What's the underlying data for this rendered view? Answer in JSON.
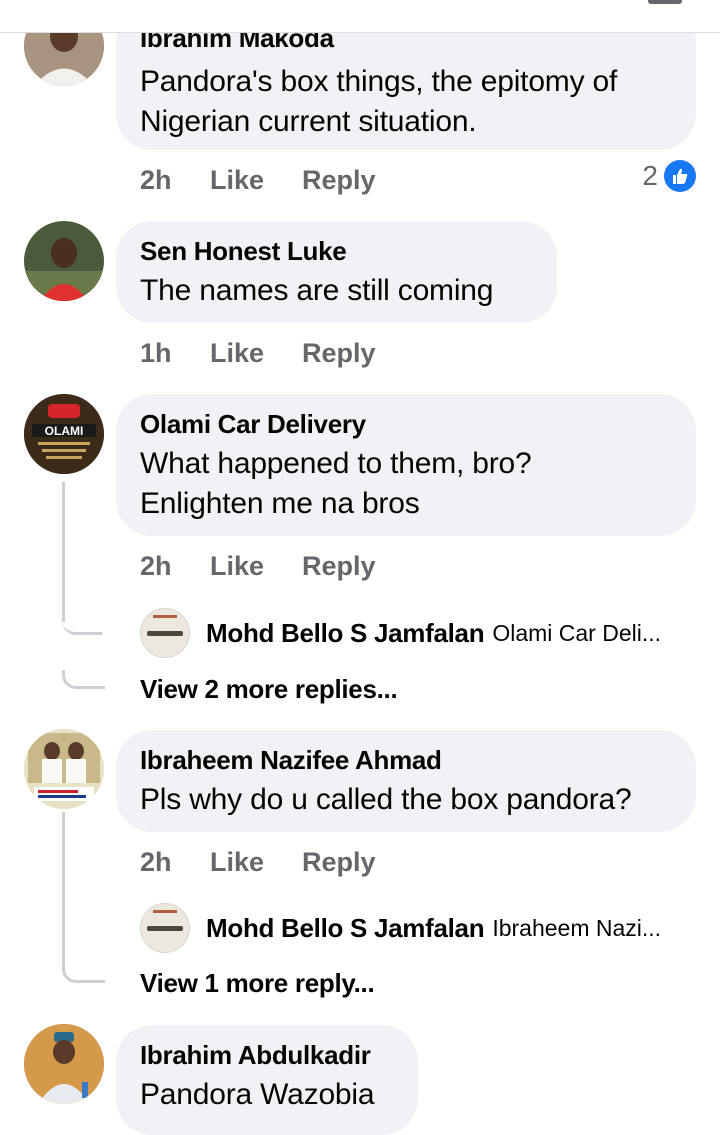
{
  "comments": [
    {
      "author": "Ibrahim Makoda",
      "text_lines": [
        "Pandora's box things, the epitomy of",
        "Nigerian current situation."
      ],
      "time": "2h",
      "like_label": "Like",
      "reply_label": "Reply",
      "reaction_count": "2",
      "avatar_icon": "user-avatar-icon"
    },
    {
      "author": "Sen Honest Luke",
      "text_lines": [
        "The names are still coming"
      ],
      "time": "1h",
      "like_label": "Like",
      "reply_label": "Reply",
      "avatar_icon": "user-avatar-icon"
    },
    {
      "author": "Olami Car Delivery",
      "text_lines": [
        "What happened to them, bro?",
        "Enlighten me na bros"
      ],
      "time": "2h",
      "like_label": "Like",
      "reply_label": "Reply",
      "avatar_text": "OLAMI",
      "reply_preview": {
        "author": "Mohd Bello S Jamfalan",
        "snippet": "Olami Car Deli..."
      },
      "view_more": "View 2 more replies..."
    },
    {
      "author": "Ibraheem Nazifee Ahmad",
      "text_lines": [
        "Pls why do u called the box pandora?"
      ],
      "time": "2h",
      "like_label": "Like",
      "reply_label": "Reply",
      "reply_preview": {
        "author": "Mohd Bello S Jamfalan",
        "snippet": "Ibraheem Nazi..."
      },
      "view_more": "View 1 more reply..."
    },
    {
      "author": "Ibrahim Abdulkadir",
      "text_lines": [
        "Pandora Wazobia"
      ],
      "avatar_icon": "user-avatar-icon"
    }
  ],
  "colors": {
    "bubble": "#f0f2f5",
    "meta_text": "#65676b",
    "like_blue": "#1877f2",
    "thread_line": "#ced0d4"
  }
}
